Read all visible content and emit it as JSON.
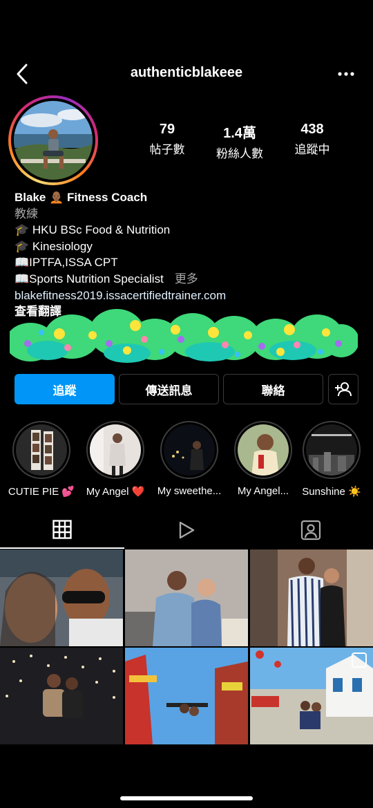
{
  "header": {
    "username": "authenticblakeee",
    "back_icon": "chevron-left-icon",
    "more_icon": "ellipsis-icon"
  },
  "stats": {
    "posts": {
      "count": "79",
      "label": "帖子數"
    },
    "followers": {
      "count": "1.4萬",
      "label": "粉絲人數"
    },
    "following": {
      "count": "438",
      "label": "追蹤中"
    }
  },
  "bio": {
    "name": "Blake 🧑🏾‍🦲 Fitness Coach",
    "category": "教練",
    "lines": [
      "🎓 HKU BSc Food & Nutrition",
      "🎓 Kinesiology",
      "📖IPTFA,ISSA CPT",
      "📖Sports Nutrition Specialist"
    ],
    "more": "更多",
    "link": "blakefitness2019.issacertifiedtrainer.com",
    "translate": "查看翻譯"
  },
  "actions": {
    "follow": "追蹤",
    "message": "傳送訊息",
    "contact": "聯絡",
    "add_user_icon": "add-user-icon"
  },
  "highlights": [
    {
      "label": "CUTIE PIE 💕"
    },
    {
      "label": "My Angel ❤️"
    },
    {
      "label": "My sweethe..."
    },
    {
      "label": "My Angel..."
    },
    {
      "label": "Sunshine ☀️"
    }
  ],
  "tabs": [
    {
      "icon": "grid-icon",
      "active": true
    },
    {
      "icon": "reels-icon",
      "active": false
    },
    {
      "icon": "tagged-icon",
      "active": false
    }
  ],
  "colors": {
    "accent": "#0095f6",
    "background": "#000000"
  }
}
